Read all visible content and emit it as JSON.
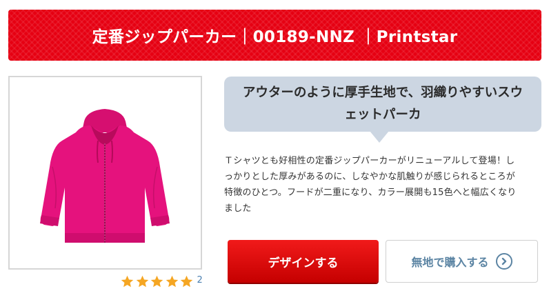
{
  "header": {
    "title": "定番ジップパーカー｜00189-NNZ ｜Printstar"
  },
  "product": {
    "image_icon": "pink-zip-hoodie",
    "color": "#e5127d"
  },
  "rating": {
    "stars": 5,
    "max_stars": 5,
    "count": "2",
    "star_color": "#f5a623"
  },
  "catch_copy": {
    "line1": "アウターのように厚手生地で、羽織りやすいスウ",
    "line2": "ェットパーカ"
  },
  "description": {
    "line1": "Ｔシャツとも好相性の定番ジップパーカーがリニューアルして登場！し",
    "line2": "っかりとした厚みがあるのに、しなやかな肌触りが感じられるところが",
    "line3": "特徴のひとつ。フードが二重になり、カラー展開も15色へと幅広くなり",
    "line4": "ました"
  },
  "actions": {
    "design_label": "デザインする",
    "plain_purchase_label": "無地で購入する",
    "arrow_icon": "chevron-right-circle-icon"
  },
  "colors": {
    "brand_red": "#e60012",
    "bubble_bg": "#ccd6e2",
    "link_blue": "#5b84a3"
  }
}
